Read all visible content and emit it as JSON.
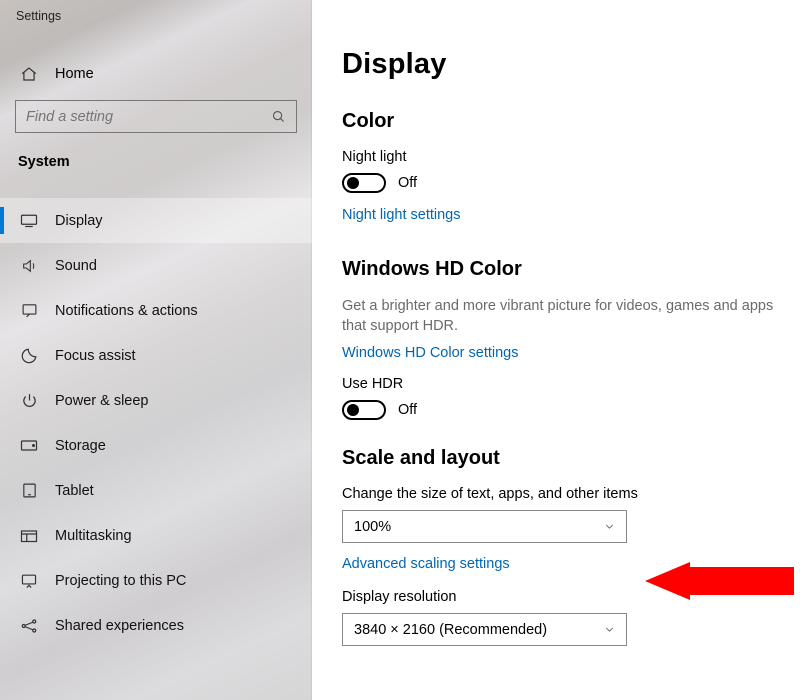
{
  "app_title": "Settings",
  "home_label": "Home",
  "search": {
    "placeholder": "Find a setting"
  },
  "section_label": "System",
  "nav": [
    {
      "key": "display",
      "label": "Display",
      "selected": true
    },
    {
      "key": "sound",
      "label": "Sound"
    },
    {
      "key": "notifications",
      "label": "Notifications & actions"
    },
    {
      "key": "focus",
      "label": "Focus assist"
    },
    {
      "key": "power",
      "label": "Power & sleep"
    },
    {
      "key": "storage",
      "label": "Storage"
    },
    {
      "key": "tablet",
      "label": "Tablet"
    },
    {
      "key": "multitasking",
      "label": "Multitasking"
    },
    {
      "key": "projecting",
      "label": "Projecting to this PC"
    },
    {
      "key": "shared",
      "label": "Shared experiences"
    }
  ],
  "main": {
    "title": "Display",
    "color": {
      "heading": "Color",
      "night_light_label": "Night light",
      "night_light_state": "Off",
      "night_light_link": "Night light settings"
    },
    "hdr": {
      "heading": "Windows HD Color",
      "desc": "Get a brighter and more vibrant picture for videos, games and apps that support HDR.",
      "link": "Windows HD Color settings",
      "use_hdr_label": "Use HDR",
      "use_hdr_state": "Off"
    },
    "scale": {
      "heading": "Scale and layout",
      "change_size_label": "Change the size of text, apps, and other items",
      "scale_value": "100%",
      "advanced_link": "Advanced scaling settings",
      "resolution_label": "Display resolution",
      "resolution_value": "3840 × 2160 (Recommended)"
    }
  }
}
